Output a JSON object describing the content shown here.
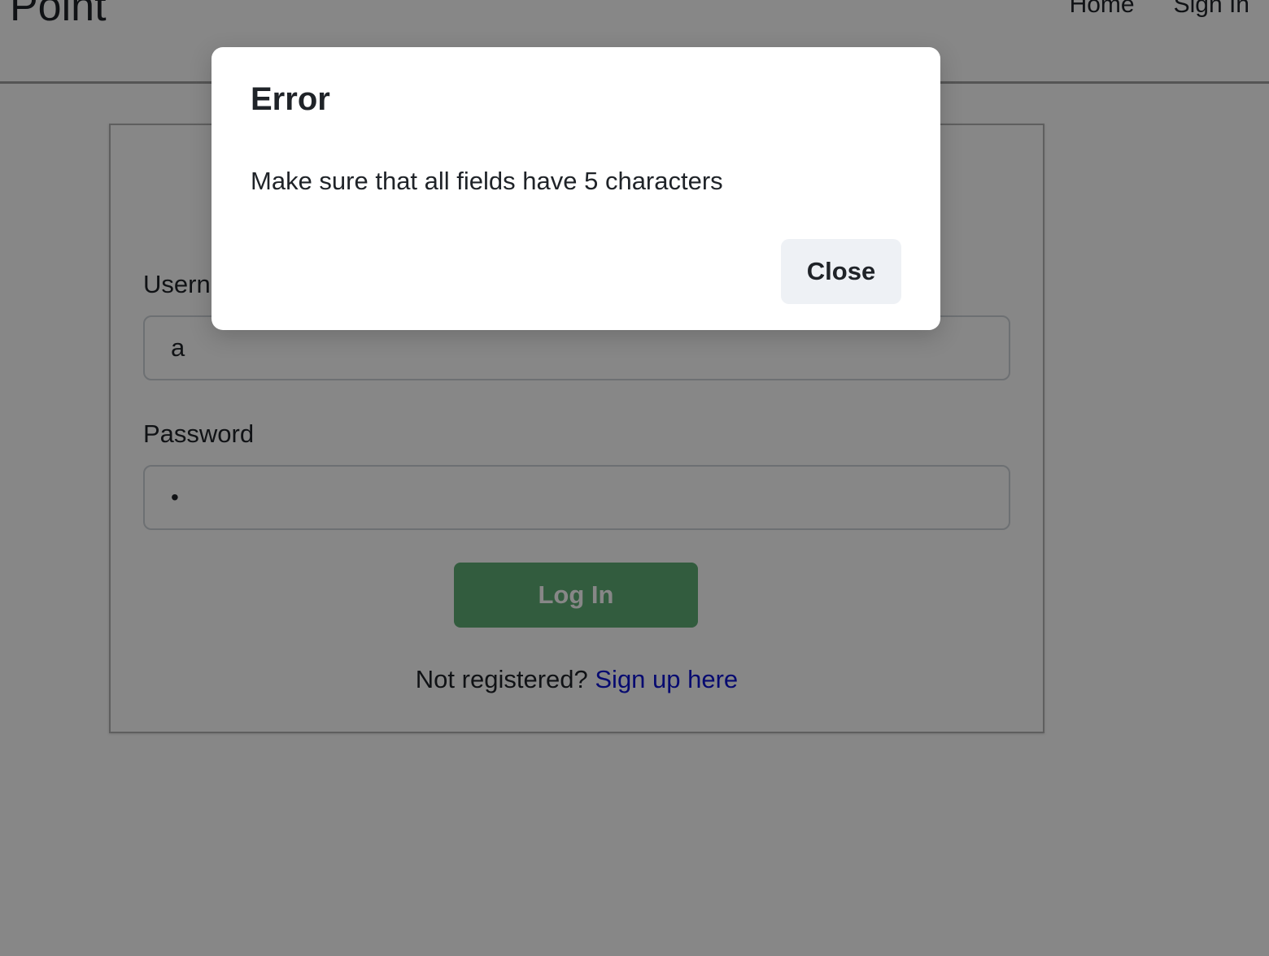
{
  "navbar": {
    "brand": "Point",
    "links": [
      {
        "label": "Home"
      },
      {
        "label": "Sign In"
      }
    ]
  },
  "login_form": {
    "username_label": "Username",
    "username_value": "a",
    "password_label": "Password",
    "password_value": "a",
    "submit_label": "Log In",
    "register_prompt": "Not registered?",
    "register_link": "Sign up here"
  },
  "modal": {
    "title": "Error",
    "message": "Make sure that all fields have 5 characters",
    "close_label": "Close"
  },
  "colors": {
    "primary_button": "#5fae75",
    "link": "#0d13d4",
    "secondary_button": "#eef1f5",
    "backdrop": "rgba(0,0,0,0.47)"
  }
}
